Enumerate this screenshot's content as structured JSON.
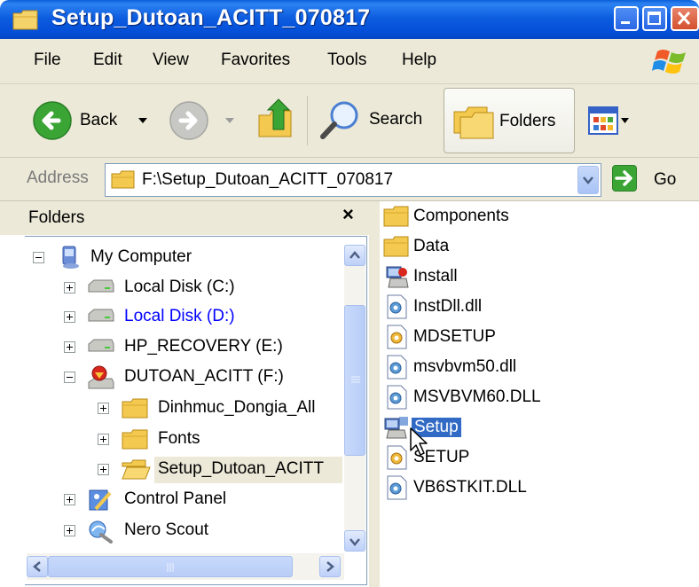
{
  "window": {
    "title": "Setup_Dutoan_ACITT_070817"
  },
  "menu": {
    "items": [
      "File",
      "Edit",
      "View",
      "Favorites",
      "Tools",
      "Help"
    ]
  },
  "toolbar": {
    "back_label": "Back",
    "search_label": "Search",
    "folders_label": "Folders"
  },
  "address": {
    "label": "Address",
    "value": "F:\\Setup_Dutoan_ACITT_070817",
    "go_label": "Go"
  },
  "folders_pane": {
    "title": "Folders",
    "close_glyph": "×",
    "tree": [
      {
        "label": "My Computer",
        "icon": "computer-icon",
        "expander": "minus"
      },
      {
        "label": "Local Disk (C:)",
        "icon": "drive-icon",
        "expander": "plus"
      },
      {
        "label": "Local Disk (D:)",
        "icon": "drive-icon",
        "expander": "plus",
        "color": "#0000ff"
      },
      {
        "label": "HP_RECOVERY (E:)",
        "icon": "drive-icon",
        "expander": "plus"
      },
      {
        "label": "DUTOAN_ACITT (F:)",
        "icon": "cd-drive-icon",
        "expander": "minus"
      },
      {
        "label": "Dinhmuc_Dongia_All",
        "icon": "folder-icon",
        "expander": "plus"
      },
      {
        "label": "Fonts",
        "icon": "folder-icon",
        "expander": "plus"
      },
      {
        "label": "Setup_Dutoan_ACITT",
        "icon": "open-folder-icon",
        "expander": "plus",
        "selected": true
      },
      {
        "label": "Control Panel",
        "icon": "control-panel-icon",
        "expander": "plus"
      },
      {
        "label": "Nero Scout",
        "icon": "nero-scout-icon",
        "expander": "plus"
      }
    ]
  },
  "files": [
    {
      "name": "Components",
      "icon": "folder-icon"
    },
    {
      "name": "Data",
      "icon": "folder-icon"
    },
    {
      "name": "Install",
      "icon": "install-exe-icon"
    },
    {
      "name": "InstDll.dll",
      "icon": "dll-icon"
    },
    {
      "name": "MDSETUP",
      "icon": "setup-config-icon"
    },
    {
      "name": "msvbvm50.dll",
      "icon": "dll-icon"
    },
    {
      "name": "MSVBVM60.DLL",
      "icon": "dll-icon"
    },
    {
      "name": "Setup",
      "icon": "setup-exe-icon",
      "selected": true
    },
    {
      "name": "SETUP",
      "icon": "setup-config-icon"
    },
    {
      "name": "VB6STKIT.DLL",
      "icon": "dll-icon"
    }
  ],
  "colors": {
    "titlebar": "#0550d8",
    "selection": "#316ac5",
    "chrome": "#ece9d8",
    "tree_selected": "#ece9d8"
  }
}
